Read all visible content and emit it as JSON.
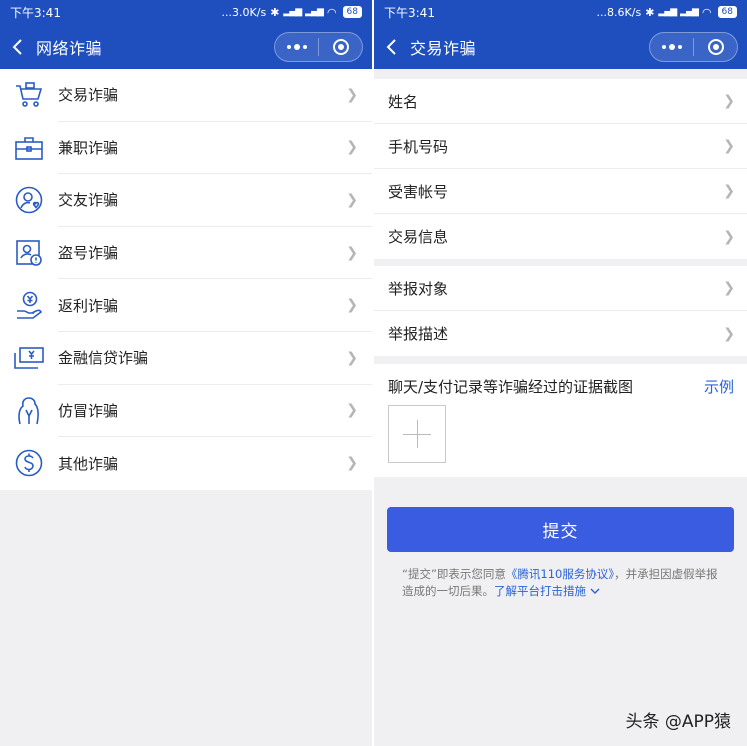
{
  "left": {
    "status": {
      "time": "下午3:41",
      "speed": "...3.0K/s",
      "battery": "68"
    },
    "nav": {
      "title": "网络诈骗"
    },
    "categories": [
      {
        "label": "交易诈骗",
        "icon": "cart-icon"
      },
      {
        "label": "兼职诈骗",
        "icon": "briefcase-icon"
      },
      {
        "label": "交友诈骗",
        "icon": "friend-heart-icon"
      },
      {
        "label": "盗号诈骗",
        "icon": "account-alert-icon"
      },
      {
        "label": "返利诈骗",
        "icon": "rebate-hand-icon"
      },
      {
        "label": "金融信贷诈骗",
        "icon": "money-card-icon"
      },
      {
        "label": "仿冒诈骗",
        "icon": "impersonate-icon"
      },
      {
        "label": "其他诈骗",
        "icon": "dollar-circle-icon"
      }
    ]
  },
  "right": {
    "status": {
      "time": "下午3:41",
      "speed": "...8.6K/s",
      "battery": "68"
    },
    "nav": {
      "title": "交易诈骗"
    },
    "group1": [
      "姓名",
      "手机号码",
      "受害帐号",
      "交易信息"
    ],
    "group2": [
      "举报对象",
      "举报描述"
    ],
    "evidence": {
      "label": "聊天/支付记录等诈骗经过的证据截图",
      "example": "示例"
    },
    "submit_label": "提交",
    "agreement": {
      "prefix": "“提交”即表示您同意",
      "link": "《腾讯110服务协议》",
      "middle": "，并承担因虚假举报造成的一切后果。",
      "learn_more": "了解平台打击措施"
    }
  },
  "watermark": "头条 @APP猿",
  "colors": {
    "brand_blue": "#1f4fbf",
    "button_blue": "#3a5ce0",
    "link_blue": "#2a63d6",
    "background": "#f0f0f2"
  }
}
